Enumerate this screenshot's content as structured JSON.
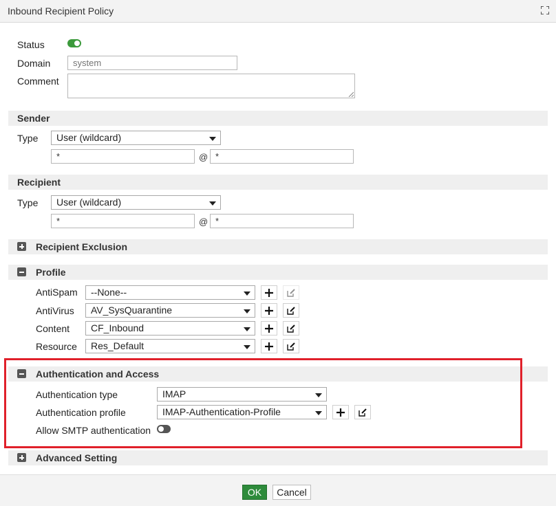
{
  "window": {
    "title": "Inbound Recipient Policy"
  },
  "general": {
    "status_label": "Status",
    "status_on": true,
    "domain_label": "Domain",
    "domain_placeholder": "system",
    "comment_label": "Comment",
    "comment_value": ""
  },
  "sender": {
    "header": "Sender",
    "type_label": "Type",
    "type_value": "User (wildcard)",
    "user_value": "*",
    "at": "@",
    "domain_value": "*"
  },
  "recipient": {
    "header": "Recipient",
    "type_label": "Type",
    "type_value": "User (wildcard)",
    "user_value": "*",
    "at": "@",
    "domain_value": "*"
  },
  "recipient_exclusion": {
    "header": "Recipient Exclusion"
  },
  "profile": {
    "header": "Profile",
    "antispam_label": "AntiSpam",
    "antispam_value": "--None--",
    "antivirus_label": "AntiVirus",
    "antivirus_value": "AV_SysQuarantine",
    "content_label": "Content",
    "content_value": "CF_Inbound",
    "resource_label": "Resource",
    "resource_value": "Res_Default"
  },
  "auth": {
    "header": "Authentication and Access",
    "type_label": "Authentication type",
    "type_value": "IMAP",
    "profile_label": "Authentication profile",
    "profile_value": "IMAP-Authentication-Profile",
    "smtp_label": "Allow SMTP authentication",
    "smtp_on": false
  },
  "advanced": {
    "header": "Advanced Setting"
  },
  "footer": {
    "ok_label": "OK",
    "cancel_label": "Cancel"
  },
  "colors": {
    "accent_green": "#2e8b3b",
    "highlight_red": "#e0202a",
    "toggle_on": "#3c9a3c"
  }
}
